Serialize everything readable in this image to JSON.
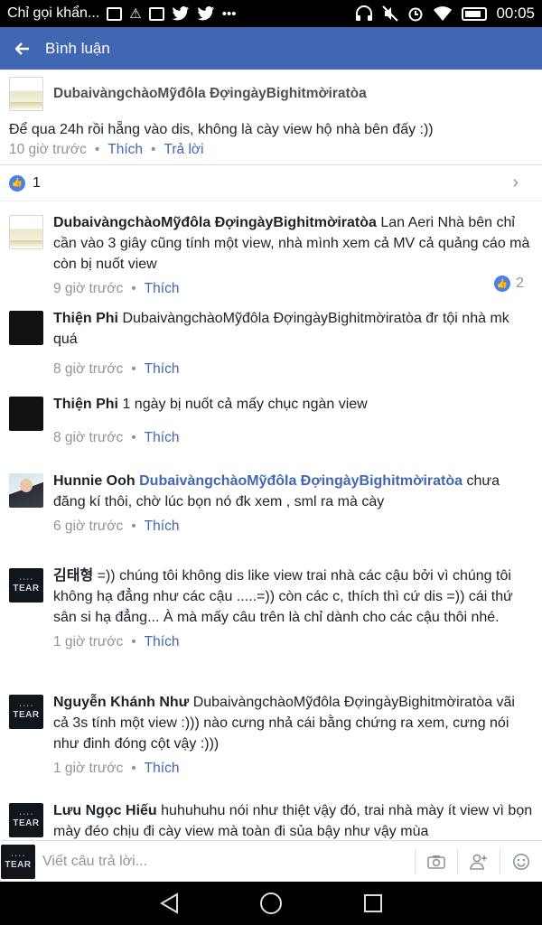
{
  "status_bar": {
    "notification_text": "Chỉ gọi khẩn...",
    "time": "00:05",
    "icons": [
      "usb-icon",
      "warning-icon",
      "image-icon",
      "twitter-icon",
      "twitter-icon",
      "more-dots-icon",
      "headset-icon",
      "mute-icon",
      "alarm-icon",
      "wifi-icon",
      "battery-icon"
    ]
  },
  "app_bar": {
    "title": "Bình luận"
  },
  "original_comment": {
    "author": "DubaivàngchàoMỹđôla ĐợingàyBighitmờiratòa",
    "text": "Để qua 24h rồi hẵng vào dis, không là cày view hộ nhà bên đấy :))",
    "time": "10 giờ trước",
    "like_label": "Thích",
    "reply_label": "Trả lời",
    "like_count": "1"
  },
  "replies": [
    {
      "author": "DubaivàngchàoMỹđôla ĐợingàyBighitmờiratòa",
      "tag": "",
      "text": "Lan Aeri Nhà bên chỉ cần vào 3 giây cũng tính một view, nhà mình xem cả MV cả quảng cáo mà còn bị nuốt view",
      "time": "9 giờ trước",
      "like_label": "Thích",
      "likes": "2"
    },
    {
      "author": "Thiện Phi",
      "tag": "",
      "text": "DubaivàngchàoMỹđôla ĐợingàyBighitmờiratòa đr tội nhà mk quá",
      "time": "8 giờ trước",
      "like_label": "Thích"
    },
    {
      "author": "Thiện Phi",
      "tag": "",
      "text": "1 ngày bị nuốt cả mấy chục ngàn view",
      "time": "8 giờ trước",
      "like_label": "Thích"
    },
    {
      "author": "Hunnie Ooh",
      "tag": "DubaivàngchàoMỹđôla ĐợingàyBighitmờiratòa",
      "text": "chưa đăng kí thôi, chờ lúc bọn nó đk xem , sml ra mà cày",
      "time": "6 giờ trước",
      "like_label": "Thích"
    },
    {
      "author": "김태형",
      "tag": "",
      "text": "=)) chúng tôi không dis like view trai nhà các cậu bởi vì chúng tôi không hạ đẳng như các cậu  .....=)) còn các c, thích thì cứ dis =)) cái thứ sân si hạ đẳng...  À mà mấy câu trên là chỉ dành cho các cậu thôi nhé.",
      "time": "1 giờ trước",
      "like_label": "Thích"
    },
    {
      "author": "Nguyễn Khánh Như",
      "tag": "",
      "text": "DubaivàngchàoMỹđôla ĐợingàyBighitmờiratòa vãi cả 3s tính một view :))) nào cưng nhả cái bằng chứng ra xem, cưng nói như đinh đóng cột vậy :)))",
      "time": "1 giờ trước",
      "like_label": "Thích"
    },
    {
      "author": "Lưu Ngọc Hiếu",
      "tag": "",
      "text": "huhuhuhu nói như thiệt vậy đó, trai nhà mày ít view vì bọn mày đéo chịu đi cày view mà toàn đi sủa bậy như vậy mùa",
      "time": "",
      "like_label": ""
    }
  ],
  "composer": {
    "placeholder": "Viết câu trả lời...",
    "avatar_text": "TEAR"
  },
  "avatar_labels": {
    "tear": "TEAR"
  },
  "colors": {
    "brand": "#4267b2",
    "status_bar": "#000000",
    "link": "#4267b2",
    "muted": "#90949c",
    "like_blue": "#4a80e8"
  }
}
